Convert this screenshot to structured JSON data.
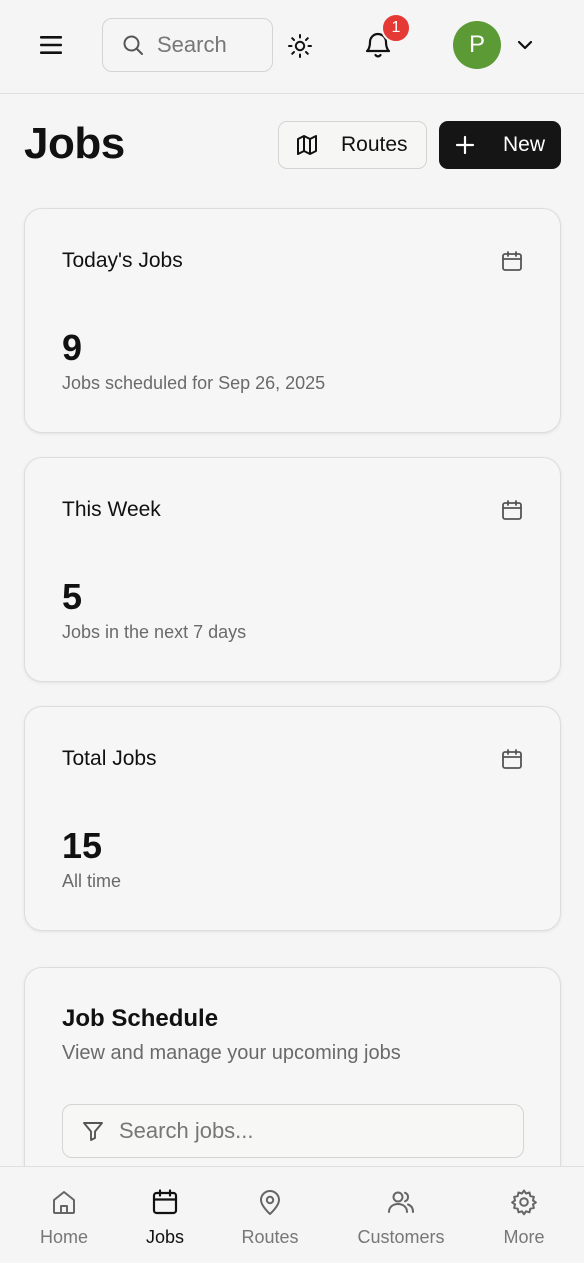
{
  "header": {
    "search_placeholder": "Search",
    "notification_count": "1",
    "avatar_initial": "P"
  },
  "page": {
    "title": "Jobs",
    "routes_button": "Routes",
    "new_button": "New"
  },
  "stats": [
    {
      "label": "Today's Jobs",
      "value": "9",
      "sub": "Jobs scheduled for Sep 26, 2025"
    },
    {
      "label": "This Week",
      "value": "5",
      "sub": "Jobs in the next 7 days"
    },
    {
      "label": "Total Jobs",
      "value": "15",
      "sub": "All time"
    }
  ],
  "schedule": {
    "title": "Job Schedule",
    "description": "View and manage your upcoming jobs",
    "search_placeholder": "Search jobs..."
  },
  "nav": {
    "items": [
      {
        "label": "Home",
        "icon": "home-icon"
      },
      {
        "label": "Jobs",
        "icon": "calendar-icon"
      },
      {
        "label": "Routes",
        "icon": "map-pin-icon"
      },
      {
        "label": "Customers",
        "icon": "users-icon"
      },
      {
        "label": "More",
        "icon": "gear-icon"
      }
    ],
    "active": "Jobs"
  },
  "colors": {
    "background": "#f4f5f4",
    "primary_button": "#151515",
    "badge": "#e53935",
    "avatar": "#5b9a35"
  }
}
